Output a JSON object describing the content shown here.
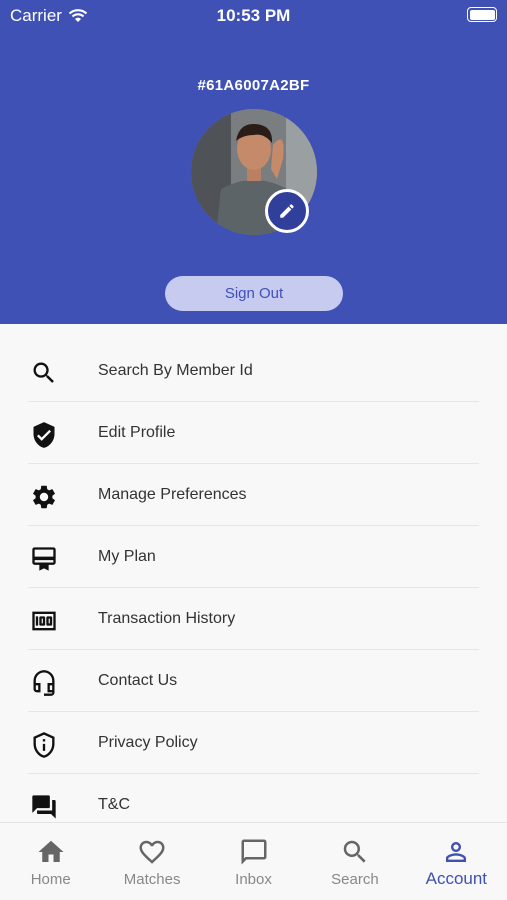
{
  "status_bar": {
    "carrier": "Carrier",
    "time": "10:53 PM"
  },
  "profile": {
    "member_id": "#61A6007A2BF",
    "sign_out_label": "Sign Out"
  },
  "menu": [
    {
      "label": "Search By Member Id",
      "icon": "search-icon"
    },
    {
      "label": "Edit Profile",
      "icon": "shield-check-icon"
    },
    {
      "label": "Manage Preferences",
      "icon": "gear-icon"
    },
    {
      "label": "My Plan",
      "icon": "card-membership-icon"
    },
    {
      "label": "Transaction History",
      "icon": "money-counter-icon"
    },
    {
      "label": "Contact Us",
      "icon": "headset-icon"
    },
    {
      "label": "Privacy Policy",
      "icon": "shield-info-icon"
    },
    {
      "label": "T&C",
      "icon": "chat-bubbles-icon"
    }
  ],
  "tabbar": [
    {
      "label": "Home",
      "icon": "home-icon"
    },
    {
      "label": "Matches",
      "icon": "heart-icon"
    },
    {
      "label": "Inbox",
      "icon": "chat-icon"
    },
    {
      "label": "Search",
      "icon": "search-icon"
    },
    {
      "label": "Account",
      "icon": "person-icon",
      "active": true
    }
  ],
  "colors": {
    "primary": "#3f51b5",
    "signout_bg": "#c6cbef",
    "tab_inactive": "#888888"
  }
}
